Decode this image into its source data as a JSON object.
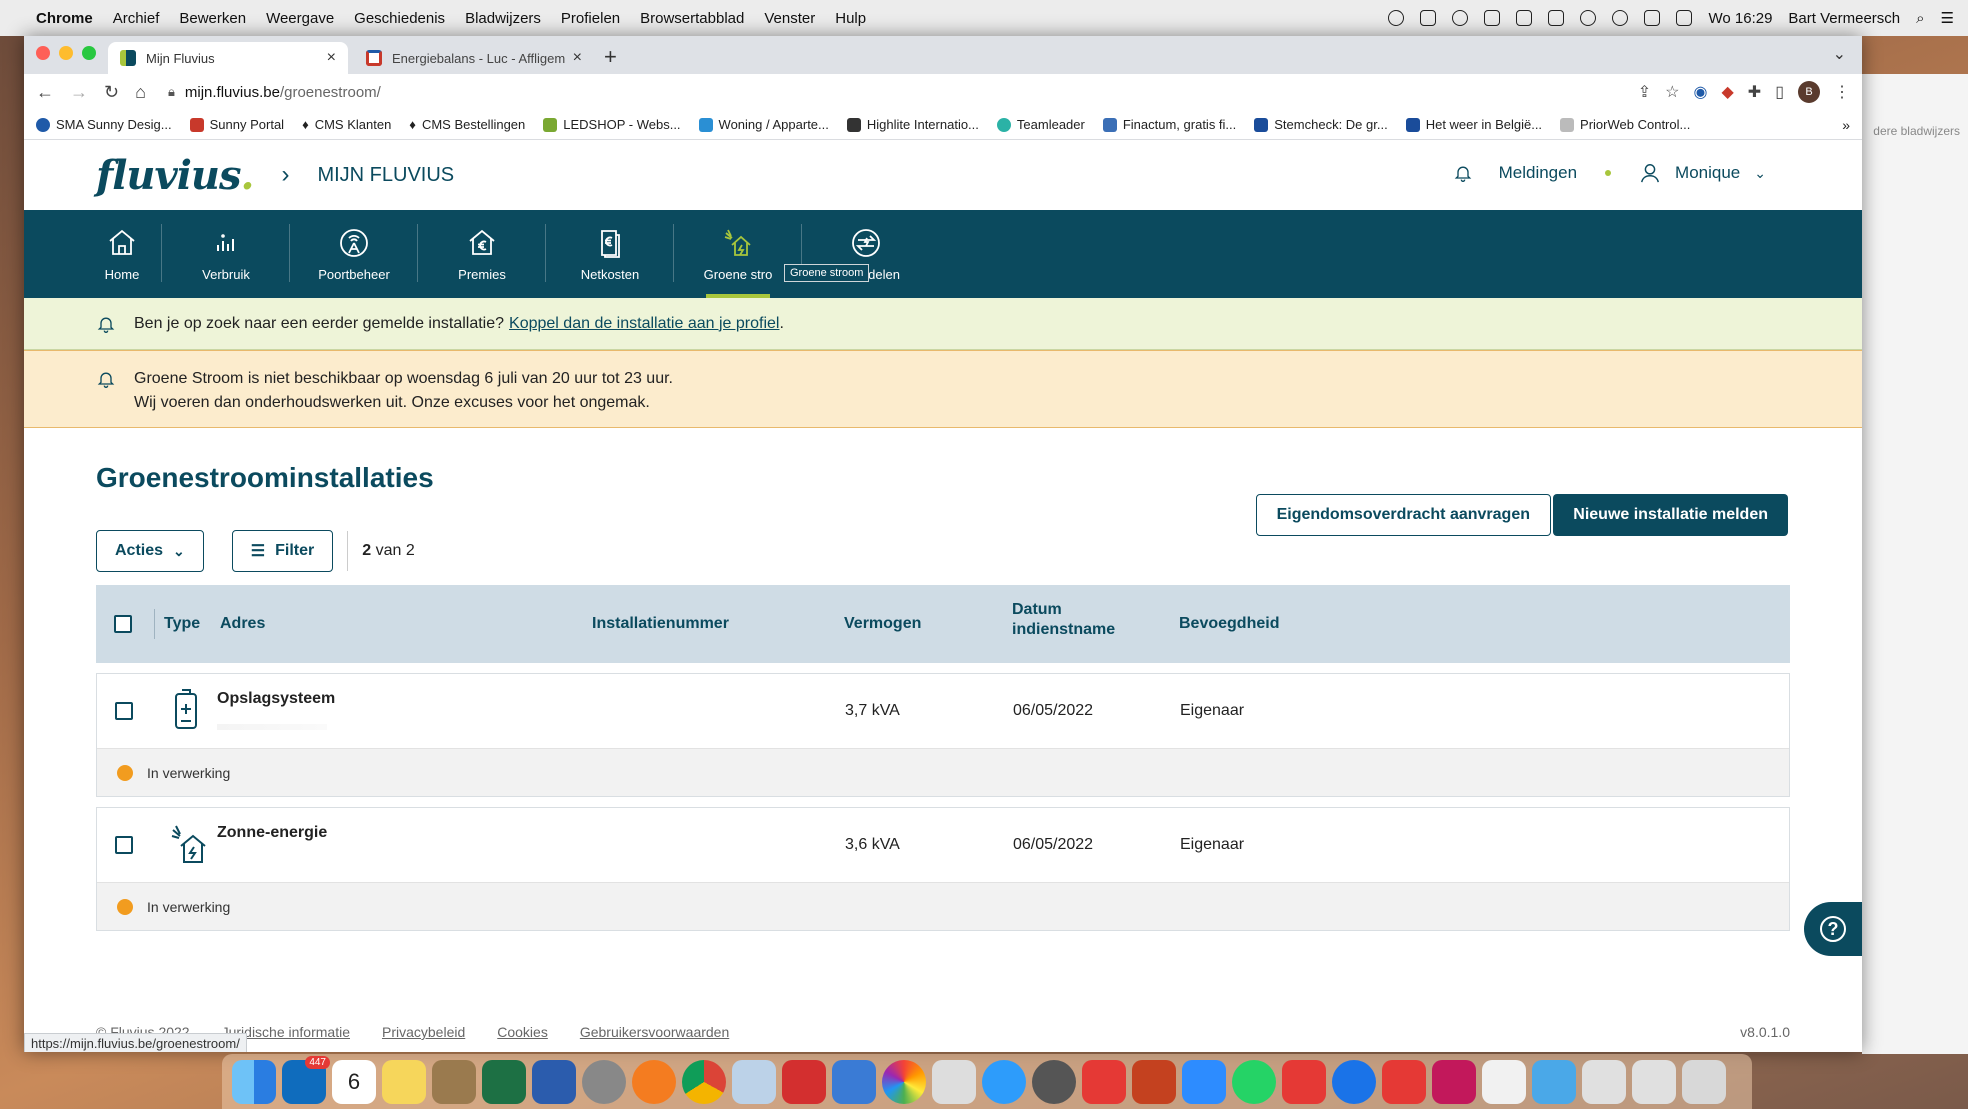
{
  "menubar": {
    "items": [
      "Chrome",
      "Archief",
      "Bewerken",
      "Weergave",
      "Geschiedenis",
      "Bladwijzers",
      "Profielen",
      "Browsertabblad",
      "Venster",
      "Hulp"
    ],
    "clock": "Wo 16:29",
    "user": "Bart Vermeersch"
  },
  "tabs": [
    {
      "title": "Mijn Fluvius",
      "favicon_color": "#0b4a5e"
    },
    {
      "title": "Energiebalans - Luc - Affligem",
      "favicon_color": "#c8392b"
    }
  ],
  "address": {
    "host": "mijn.fluvius.be",
    "path": "/groenestroom/"
  },
  "bookmarks": [
    {
      "label": "SMA Sunny Desig...",
      "color": "#1f5aa8"
    },
    {
      "label": "Sunny Portal",
      "color": "#c8392b"
    },
    {
      "label": "CMS Klanten",
      "color": "#222222"
    },
    {
      "label": "CMS Bestellingen",
      "color": "#222222"
    },
    {
      "label": "LEDSHOP - Webs...",
      "color": "#7aa832"
    },
    {
      "label": "Woning / Apparte...",
      "color": "#2a8fd4"
    },
    {
      "label": "Highlite Internatio...",
      "color": "#333333"
    },
    {
      "label": "Teamleader",
      "color": "#2bb2a6"
    },
    {
      "label": "Finactum, gratis fi...",
      "color": "#3b6fb6"
    },
    {
      "label": "Stemcheck: De gr...",
      "color": "#1a4c9a"
    },
    {
      "label": "Het weer in België...",
      "color": "#1a4c9a"
    },
    {
      "label": "PriorWeb Control...",
      "color": "#bbbbbb"
    }
  ],
  "behind_window_label": "dere bladwijzers",
  "header": {
    "logo": "fluvius",
    "app_title": "MIJN FLUVIUS",
    "notifications_label": "Meldingen",
    "user_name": "Monique"
  },
  "nav": [
    {
      "label": "Home",
      "icon": "home-icon"
    },
    {
      "label": "Verbruik",
      "icon": "bar-chart-icon"
    },
    {
      "label": "Poortbeheer",
      "icon": "antenna-icon"
    },
    {
      "label": "Premies",
      "icon": "euro-house-icon"
    },
    {
      "label": "Netkosten",
      "icon": "euro-document-icon"
    },
    {
      "label": "Groene stroom",
      "icon": "solar-house-icon",
      "active": true
    },
    {
      "label": "Energiedelen",
      "icon": "energy-share-icon"
    }
  ],
  "nav_visible_labels": [
    "Home",
    "Verbruik",
    "Poortbeheer",
    "Premies",
    "Netkosten",
    "Groene stro",
    "nergiedelen"
  ],
  "tooltip": "Groene stroom",
  "banner_info": {
    "text": "Ben je op zoek naar een eerder gemelde installatie?",
    "link": "Koppel dan de installatie aan je profiel",
    "end": "."
  },
  "banner_warning": {
    "line1": "Groene Stroom is niet beschikbaar op woensdag 6 juli van 20 uur tot 23 uur.",
    "line2": "Wij voeren dan onderhoudswerken uit. Onze excuses voor het ongemak."
  },
  "page_title": "Groenestroominstallaties",
  "buttons": {
    "transfer": "Eigendomsoverdracht aanvragen",
    "new": "Nieuwe installatie melden",
    "actions": "Acties",
    "filter": "Filter"
  },
  "count": {
    "shown": "2",
    "suffix": "van 2"
  },
  "table": {
    "headers": {
      "type": "Type",
      "address": "Adres",
      "number": "Installatienummer",
      "power": "Vermogen",
      "date_line1": "Datum",
      "date_line2": "indienstname",
      "authority": "Bevoegdheid"
    },
    "rows": [
      {
        "name": "Opslagsysteem",
        "icon": "battery-icon",
        "power": "3,7 kVA",
        "date": "06/05/2022",
        "authority": "Eigenaar",
        "status": "In verwerking",
        "status_color": "#f29c1f"
      },
      {
        "name": "Zonne-energie",
        "icon": "solar-house-icon",
        "power": "3,6 kVA",
        "date": "06/05/2022",
        "authority": "Eigenaar",
        "status": "In verwerking",
        "status_color": "#f29c1f"
      }
    ]
  },
  "footer": {
    "copyright": "© Fluvius 2022",
    "links": [
      "Juridische informatie",
      "Privacybeleid",
      "Cookies",
      "Gebruikersvoorwaarden"
    ],
    "version": "v8.0.1.0"
  },
  "status_url": "https://mijn.fluvius.be/groenestroom/",
  "dock_badges": {
    "outlook": "447",
    "calendar": "6"
  },
  "colors": {
    "brand": "#0b4a5e",
    "accent": "#a8c63c",
    "warning_bg": "#fceccd",
    "info_bg": "#eef4d8"
  }
}
